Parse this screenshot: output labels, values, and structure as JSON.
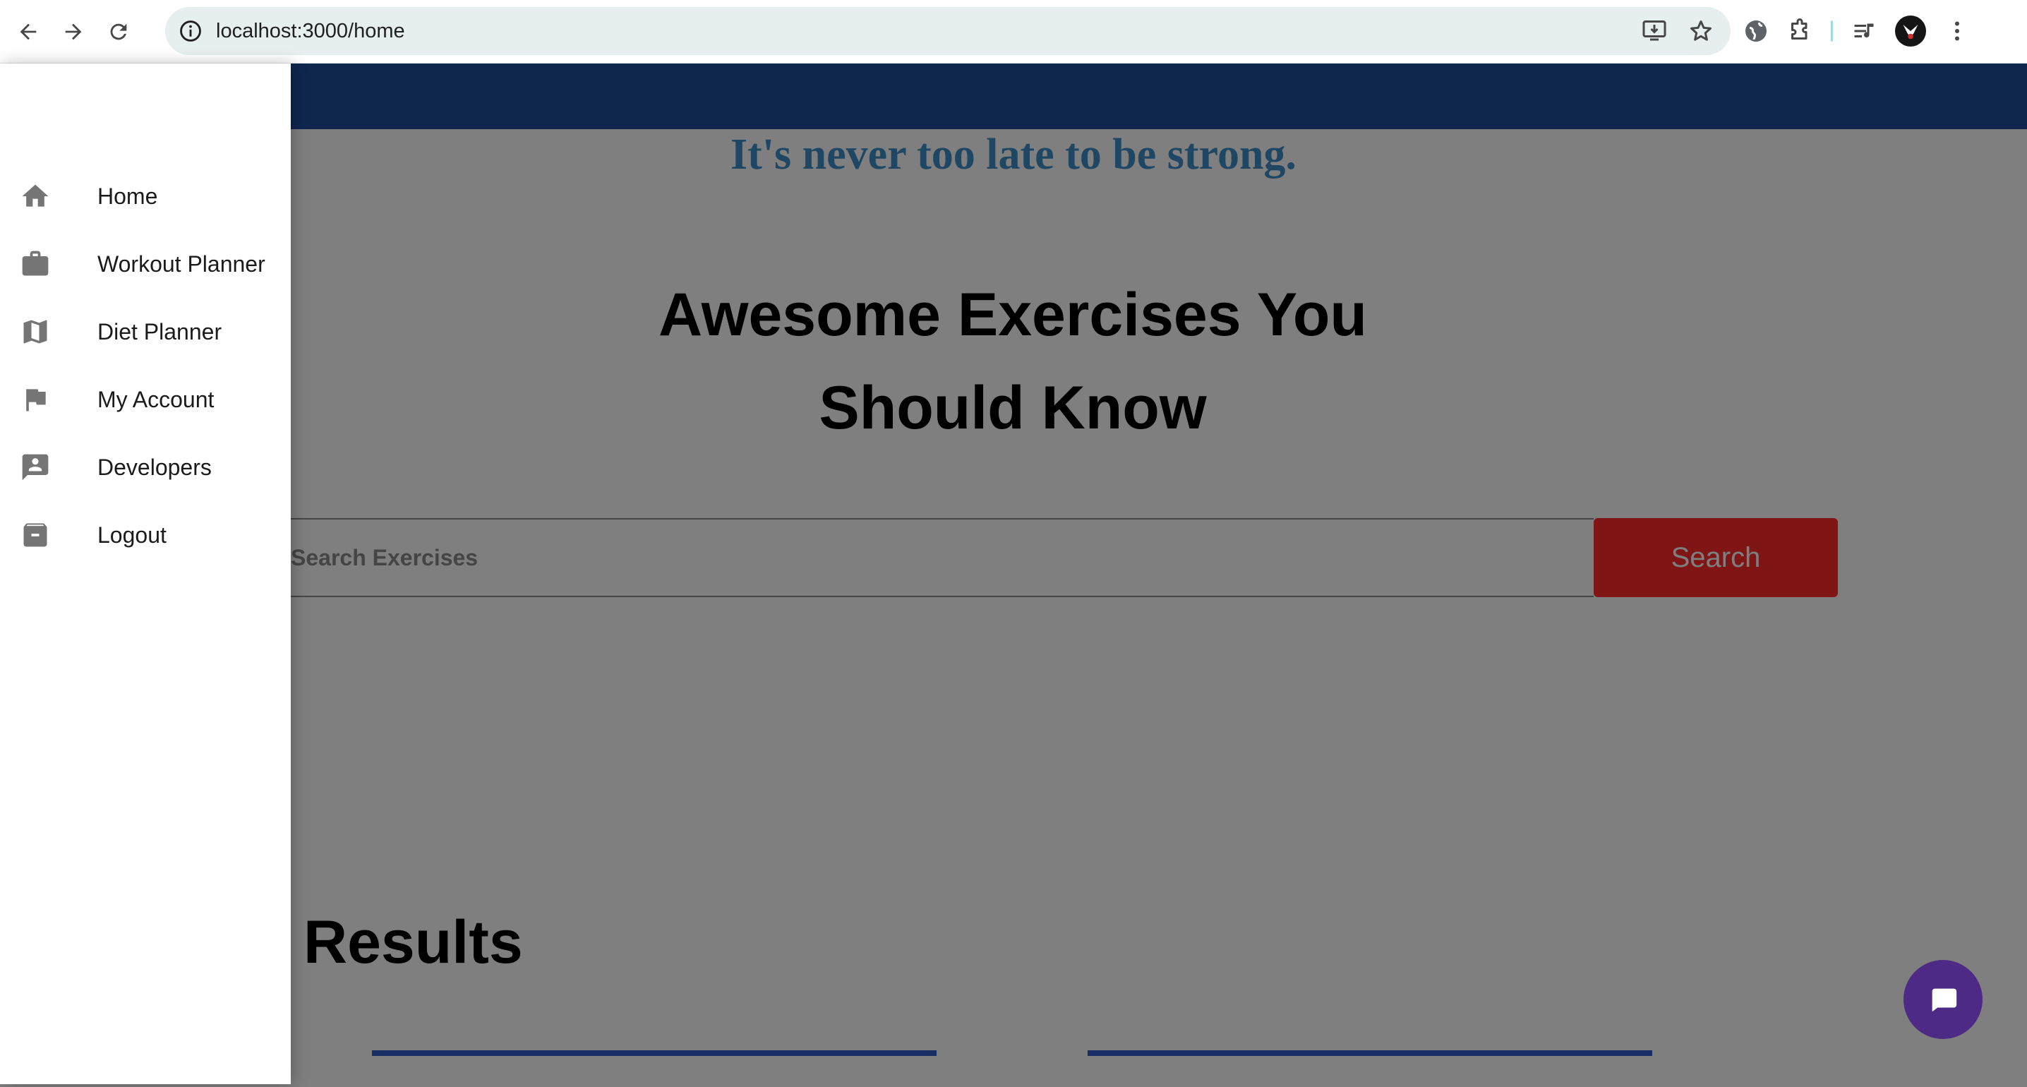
{
  "browser": {
    "url": "localhost:3000/home",
    "icons": {
      "back": "arrow-left-icon",
      "forward": "arrow-right-icon",
      "reload": "reload-icon",
      "site_info": "info-icon",
      "install": "install-app-icon",
      "bookmark": "star-icon",
      "extension_1": "extension-globe-icon",
      "extensions": "puzzle-icon",
      "media": "media-queue-icon",
      "profile": "avatar-icon",
      "menu": "kebab-menu-icon"
    }
  },
  "page": {
    "tagline": "It's never too late to be strong.",
    "heading_line1": "Awesome Exercises You",
    "heading_line2": "Should Know",
    "search": {
      "placeholder": "Search Exercises",
      "button_label": "Search"
    },
    "results_title": "Results",
    "colors": {
      "app_bar": "#1e4f9e",
      "tagline": "#3f8fc7",
      "search_button": "#ff2b2b",
      "chat_button": "#4c2a86"
    }
  },
  "drawer": {
    "items": [
      {
        "label": "Home",
        "icon": "home-icon"
      },
      {
        "label": "Workout Planner",
        "icon": "briefcase-icon"
      },
      {
        "label": "Diet Planner",
        "icon": "map-icon"
      },
      {
        "label": "My Account",
        "icon": "flag-icon"
      },
      {
        "label": "Developers",
        "icon": "contact-icon"
      },
      {
        "label": "Logout",
        "icon": "archive-icon"
      }
    ]
  },
  "chat": {
    "icon": "chat-bubble-icon"
  }
}
